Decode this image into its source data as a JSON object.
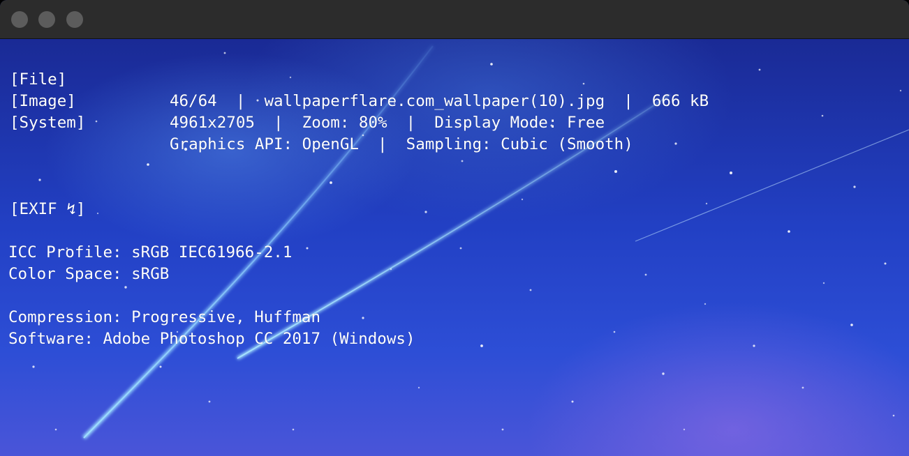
{
  "window": {
    "traffic_lights": [
      "close",
      "minimize",
      "maximize"
    ]
  },
  "overlay": {
    "file": {
      "tag": "[File]",
      "value": "46/64  |  wallpaperflare.com_wallpaper(10).jpg  |  666 kB"
    },
    "image": {
      "tag": "[Image]",
      "value": "4961x2705  |  Zoom: 80%  |  Display Mode: Free"
    },
    "system": {
      "tag": "[System]",
      "value": "Graphics API: OpenGL  |  Sampling: Cubic (Smooth)"
    },
    "exif_header": "[EXIF ↯]",
    "exif": {
      "icc_profile": "ICC Profile: sRGB IEC61966-2.1",
      "color_space": "Color Space: sRGB",
      "compression": "Compression: Progressive, Huffman",
      "software": "Software: Adobe Photoshop CC 2017 (Windows)"
    }
  },
  "background": {
    "description_colors": [
      "#1a2a95",
      "#2240c4",
      "#2d4ed6",
      "#4a55d8"
    ]
  }
}
